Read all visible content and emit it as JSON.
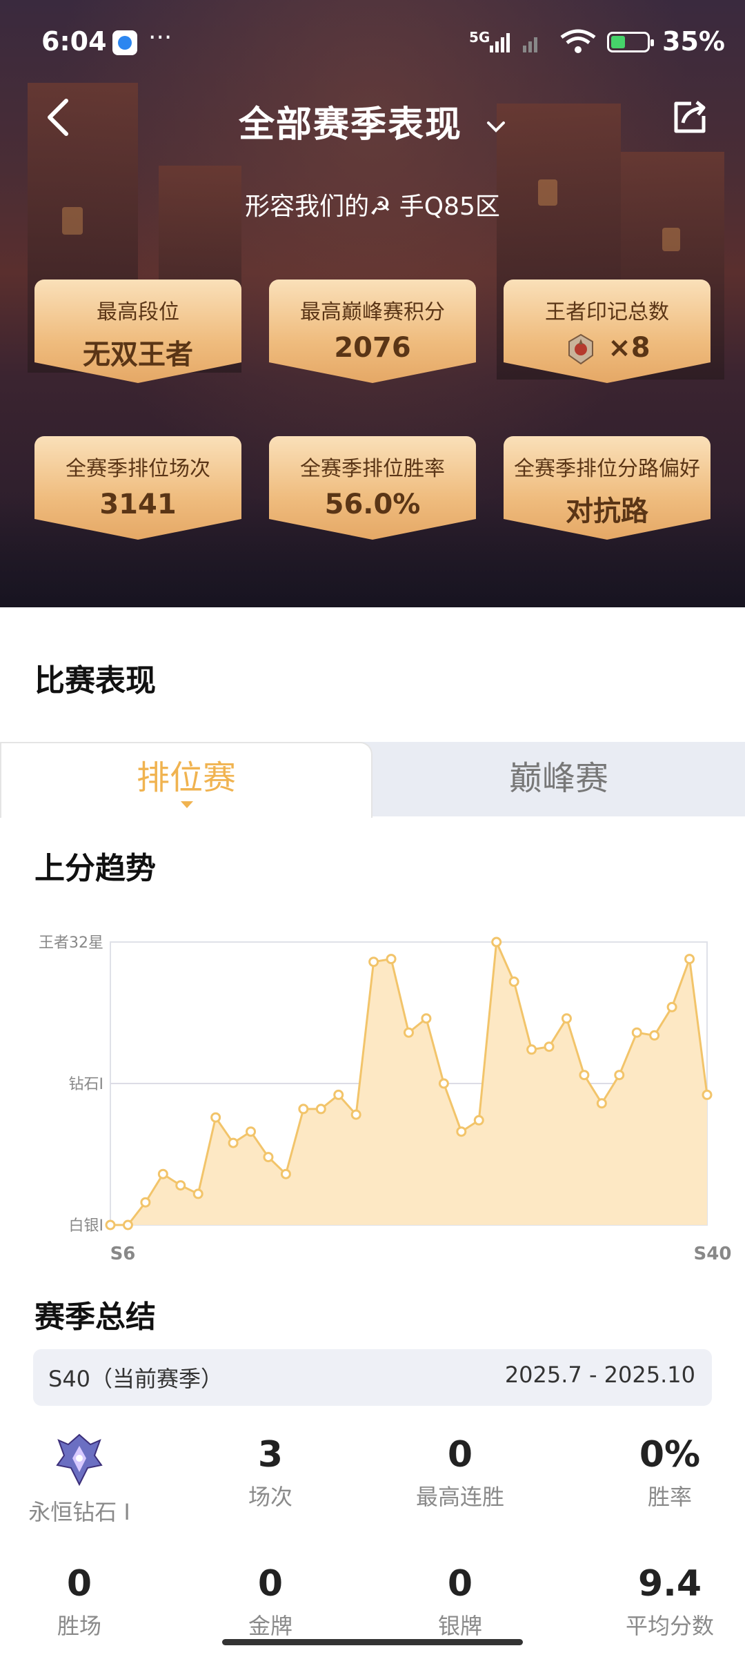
{
  "status_bar": {
    "time": "6:04",
    "more": "···",
    "network": "5G",
    "battery": "35%"
  },
  "nav": {
    "title": "全部赛季表现"
  },
  "profile": {
    "subtitle": "形容我们的☭ 手Q85区"
  },
  "stat_cards": [
    {
      "label": "最高段位",
      "value": "无双王者"
    },
    {
      "label": "最高巅峰赛积分",
      "value": "2076"
    },
    {
      "label": "王者印记总数",
      "value": "×8"
    },
    {
      "label": "全赛季排位场次",
      "value": "3141"
    },
    {
      "label": "全赛季排位胜率",
      "value": "56.0%"
    },
    {
      "label": "全赛季排位分路偏好",
      "value": "对抗路"
    }
  ],
  "performance": {
    "title": "比赛表现"
  },
  "tabs": [
    {
      "label": "排位赛"
    },
    {
      "label": "巅峰赛"
    }
  ],
  "trend": {
    "title": "上分趋势"
  },
  "chart_data": {
    "type": "area",
    "title": "上分趋势",
    "x_start_label": "S6",
    "x_end_label": "S40",
    "y_tick_labels": [
      "王者32星",
      "钻石I",
      "白银I"
    ],
    "y_tick_values": [
      100,
      50,
      0
    ],
    "ylim": [
      0,
      100
    ],
    "grid": "horizontal at 钻石I",
    "color": "#f2c46a",
    "fill": "#fde8c4",
    "values": [
      0,
      0,
      8,
      18,
      14,
      11,
      38,
      29,
      33,
      24,
      18,
      41,
      41,
      46,
      39,
      93,
      94,
      68,
      73,
      50,
      33,
      37,
      100,
      86,
      62,
      63,
      73,
      53,
      43,
      53,
      68,
      67,
      77,
      94,
      46
    ]
  },
  "season_summary": {
    "title": "赛季总结",
    "season_label": "S40（当前赛季）",
    "date_range": "2025.7 - 2025.10",
    "rank": "永恒钻石 I",
    "stats_row1": [
      {
        "value": "3",
        "label": "场次"
      },
      {
        "value": "0",
        "label": "最高连胜"
      },
      {
        "value": "0%",
        "label": "胜率"
      }
    ],
    "stats_row2": [
      {
        "value": "0",
        "label": "胜场"
      },
      {
        "value": "0",
        "label": "金牌"
      },
      {
        "value": "0",
        "label": "银牌"
      },
      {
        "value": "9.4",
        "label": "平均分数"
      }
    ]
  }
}
